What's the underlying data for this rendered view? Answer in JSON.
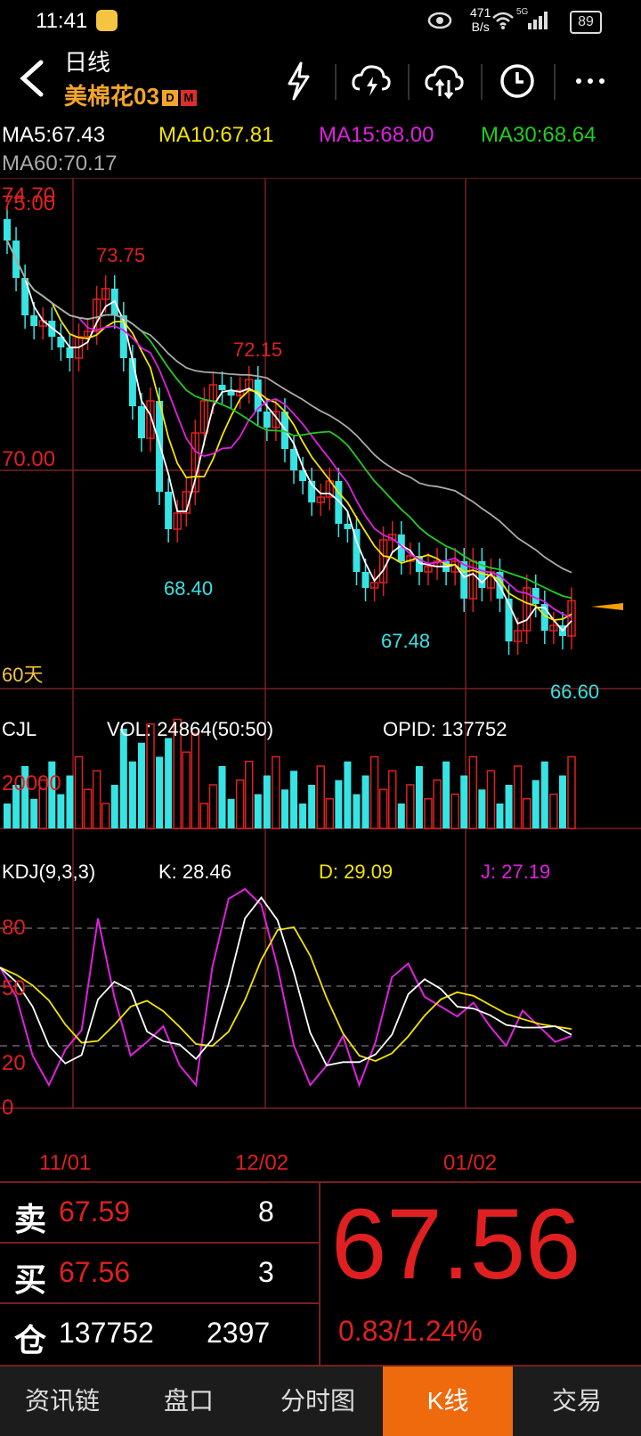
{
  "status_bar": {
    "time": "11:41",
    "net_speed_value": "471",
    "net_speed_unit": "B/s",
    "signal": "5G",
    "battery": "89"
  },
  "header": {
    "period": "日线",
    "contract": "美棉花03",
    "tag_d": "D",
    "tag_m": "M",
    "icons": [
      "back-arrow-icon",
      "lightning-icon",
      "cloud-download-icon",
      "cloud-upload-icon",
      "clock-icon",
      "more-icon"
    ]
  },
  "ma": {
    "ma5": "MA5:67.43",
    "ma10": "MA10:67.81",
    "ma15": "MA15:68.00",
    "ma30": "MA30:68.64",
    "ma60": "MA60:70.17"
  },
  "price_axis": {
    "top_a": "74.70",
    "top_b": "75.00",
    "mid": "70.00",
    "range_label": "60天"
  },
  "price_annotations": {
    "high1": "73.75",
    "high2": "72.15",
    "low1": "68.40",
    "low2": "67.48",
    "low3": "66.60"
  },
  "volume": {
    "title": "CJL",
    "vol": "VOL: 24864(50:50)",
    "opid": "OPID: 137752",
    "axis": "20000"
  },
  "kdj": {
    "title": "KDJ(9,3,3)",
    "k": "K: 28.46",
    "d": "D: 29.09",
    "j": "J: 27.19",
    "levels": [
      "80",
      "50",
      "20",
      "0"
    ]
  },
  "dates": [
    "11/01",
    "12/02",
    "01/02"
  ],
  "order_book": {
    "sell_label": "卖",
    "sell_price": "67.59",
    "sell_qty": "8",
    "buy_label": "买",
    "buy_price": "67.56",
    "buy_qty": "3",
    "oi_label": "仓",
    "oi_value": "137752",
    "oi_change": "2397",
    "last_price": "67.56",
    "change": "0.83/1.24%"
  },
  "tabs": [
    {
      "label": "资讯链",
      "active": false
    },
    {
      "label": "盘口",
      "active": false
    },
    {
      "label": "分时图",
      "active": false
    },
    {
      "label": "K线",
      "active": true
    },
    {
      "label": "交易",
      "active": false
    }
  ],
  "colors": {
    "up": "#e02020",
    "down": "#36e4e4",
    "accent": "#ee6a0d",
    "ma5": "#ffffff",
    "ma10": "#f5e400",
    "ma15": "#e020e0",
    "ma30": "#22cc22",
    "ma60": "#aaaaaa"
  }
}
